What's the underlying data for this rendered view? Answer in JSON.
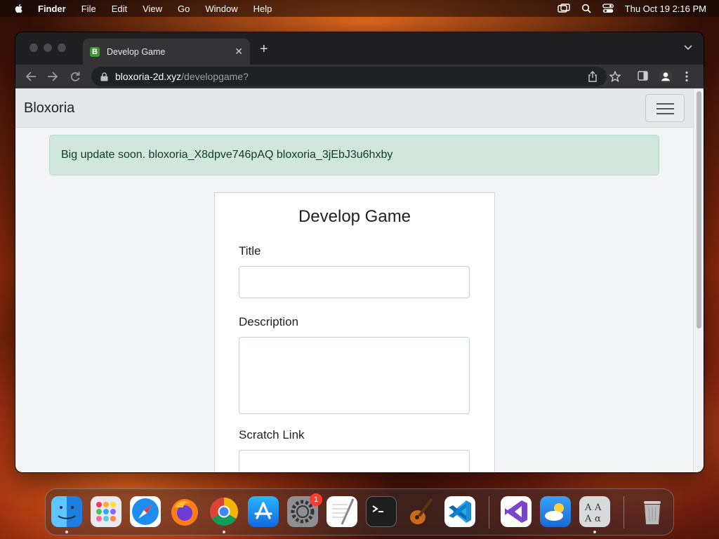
{
  "menubar": {
    "app": "Finder",
    "items": [
      "File",
      "Edit",
      "View",
      "Go",
      "Window",
      "Help"
    ],
    "clock": "Thu Oct 19  2:16 PM"
  },
  "browser": {
    "tab_title": "Develop Game",
    "tab_favicon": "B",
    "url_host": "bloxoria-2d.xyz",
    "url_path": "/developgame?"
  },
  "page": {
    "brand": "Bloxoria",
    "alert": "Big update soon. bloxoria_X8dpve746pAQ bloxoria_3jEbJ3u6hxby",
    "form": {
      "heading": "Develop Game",
      "title_label": "Title",
      "title_value": "",
      "description_label": "Description",
      "description_value": "",
      "scratch_label": "Scratch Link",
      "scratch_value": ""
    }
  },
  "dock": {
    "settings_badge": "1",
    "apps": [
      "Finder",
      "Launchpad",
      "Safari",
      "Firefox",
      "Google Chrome",
      "App Store",
      "System Settings",
      "TextEdit",
      "Terminal",
      "GarageBand",
      "Visual Studio Code",
      "Visual Studio",
      "Weather",
      "Font Book",
      "Trash"
    ]
  },
  "colors": {
    "alert_bg": "#d1e7dd",
    "alert_text": "#0f3a28",
    "navbar_bg": "#e5e6e8",
    "tab_bg": "#343437"
  }
}
